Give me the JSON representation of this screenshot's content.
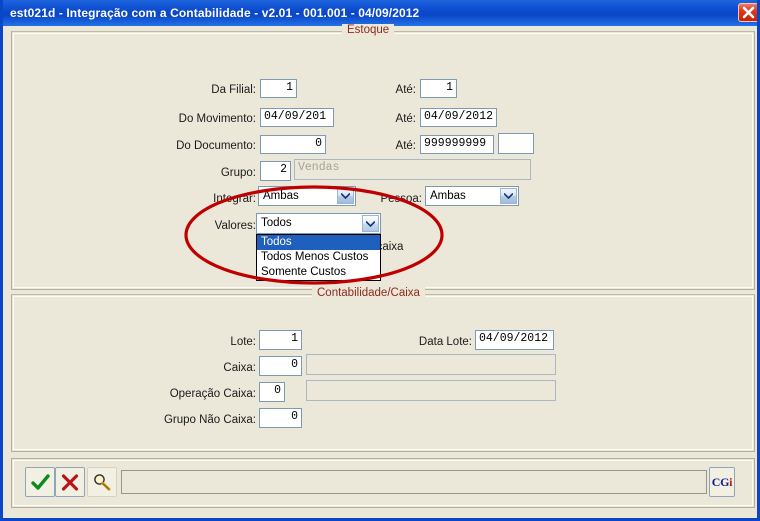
{
  "window": {
    "title": "est021d - Integração com a Contabilidade - v2.01 - 001.001 - 04/09/2012",
    "close_icon": "close-icon"
  },
  "estoque": {
    "legend": "Estoque",
    "rows": {
      "filial": {
        "label": "Da Filial:",
        "value": "1",
        "ate_label": "Até:",
        "ate_value": "1"
      },
      "movimento": {
        "label": "Do Movimento:",
        "value": "04/09/201",
        "ate_label": "Até:",
        "ate_value": "04/09/2012"
      },
      "documento": {
        "label": "Do Documento:",
        "value": "0",
        "ate_label": "Até:",
        "ate_value": "999999999",
        "extra_value": ""
      },
      "grupo": {
        "label": "Grupo:",
        "value": "2",
        "description": "Vendas"
      },
      "integrar": {
        "label": "Integrar:",
        "value": "Ambas"
      },
      "pessoa": {
        "label": "Pessoa:",
        "value": "Ambas"
      },
      "valores": {
        "label": "Valores:",
        "value": "Todos"
      }
    },
    "valores_options": [
      {
        "label": "Todos",
        "selected": true
      },
      {
        "label": "Todos Menos Custos",
        "selected": false
      },
      {
        "label": "Somente Custos",
        "selected": false
      }
    ],
    "obscured_text": "s pelo gaveta caixa"
  },
  "contabilidade": {
    "legend": "Contabilidade/Caixa",
    "lote": {
      "label": "Lote:",
      "value": "1"
    },
    "data_lote": {
      "label": "Data Lote:",
      "value": "04/09/2012"
    },
    "caixa": {
      "label": "Caixa:",
      "value": "0",
      "description": ""
    },
    "operacao_caixa": {
      "label": "Operação Caixa:",
      "value": "0",
      "description": ""
    },
    "grupo_nao_caixa": {
      "label": "Grupo Não Caixa:",
      "value": "0"
    }
  },
  "toolbar": {
    "confirm_icon": "check-icon",
    "cancel_icon": "x-icon",
    "search_icon": "magnifier-icon",
    "status_value": "",
    "logo_text": "CG",
    "logo_accent": "i"
  },
  "annotation": {
    "shape": "ellipse",
    "color": "#C00000"
  }
}
